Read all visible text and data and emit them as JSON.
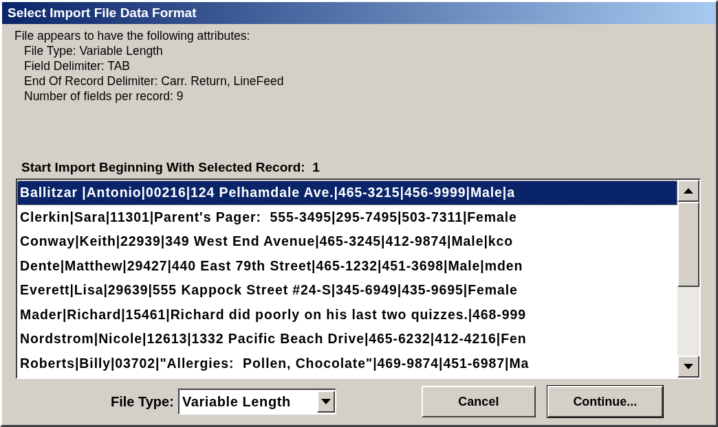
{
  "window": {
    "title": "Select Import File Data Format"
  },
  "attributes": {
    "heading": "File appears to have the following attributes:",
    "lines": [
      "File Type: Variable Length",
      "Field Delimiter: TAB",
      "End Of Record Delimiter: Carr. Return, LineFeed",
      "Number of fields per record: 9"
    ]
  },
  "start_label": "Start Import Beginning With Selected Record:  1",
  "records": [
    {
      "text": "Ballitzar |Antonio|00216|124 Pelhamdale Ave.|465-3215|456-9999|Male|a",
      "selected": true
    },
    {
      "text": "Clerkin|Sara|11301|Parent's Pager:  555-3495|295-7495|503-7311|Female",
      "selected": false
    },
    {
      "text": "Conway|Keith|22939|349 West End Avenue|465-3245|412-9874|Male|kco",
      "selected": false
    },
    {
      "text": "Dente|Matthew|29427|440 East 79th Street|465-1232|451-3698|Male|mden",
      "selected": false
    },
    {
      "text": "Everett|Lisa|29639|555 Kappock Street #24-S|345-6949|435-9695|Female",
      "selected": false
    },
    {
      "text": "Mader|Richard|15461|Richard did poorly on his last two quizzes.|468-999",
      "selected": false
    },
    {
      "text": "Nordstrom|Nicole|12613|1332 Pacific Beach Drive|465-6232|412-4216|Fen",
      "selected": false
    },
    {
      "text": "Roberts|Billy|03702|\"Allergies:  Pollen, Chocolate\"|469-9874|451-6987|Ma",
      "selected": false
    }
  ],
  "file_type": {
    "label": "File Type:",
    "value": "Variable Length"
  },
  "buttons": [
    "Cancel",
    "Continue..."
  ]
}
